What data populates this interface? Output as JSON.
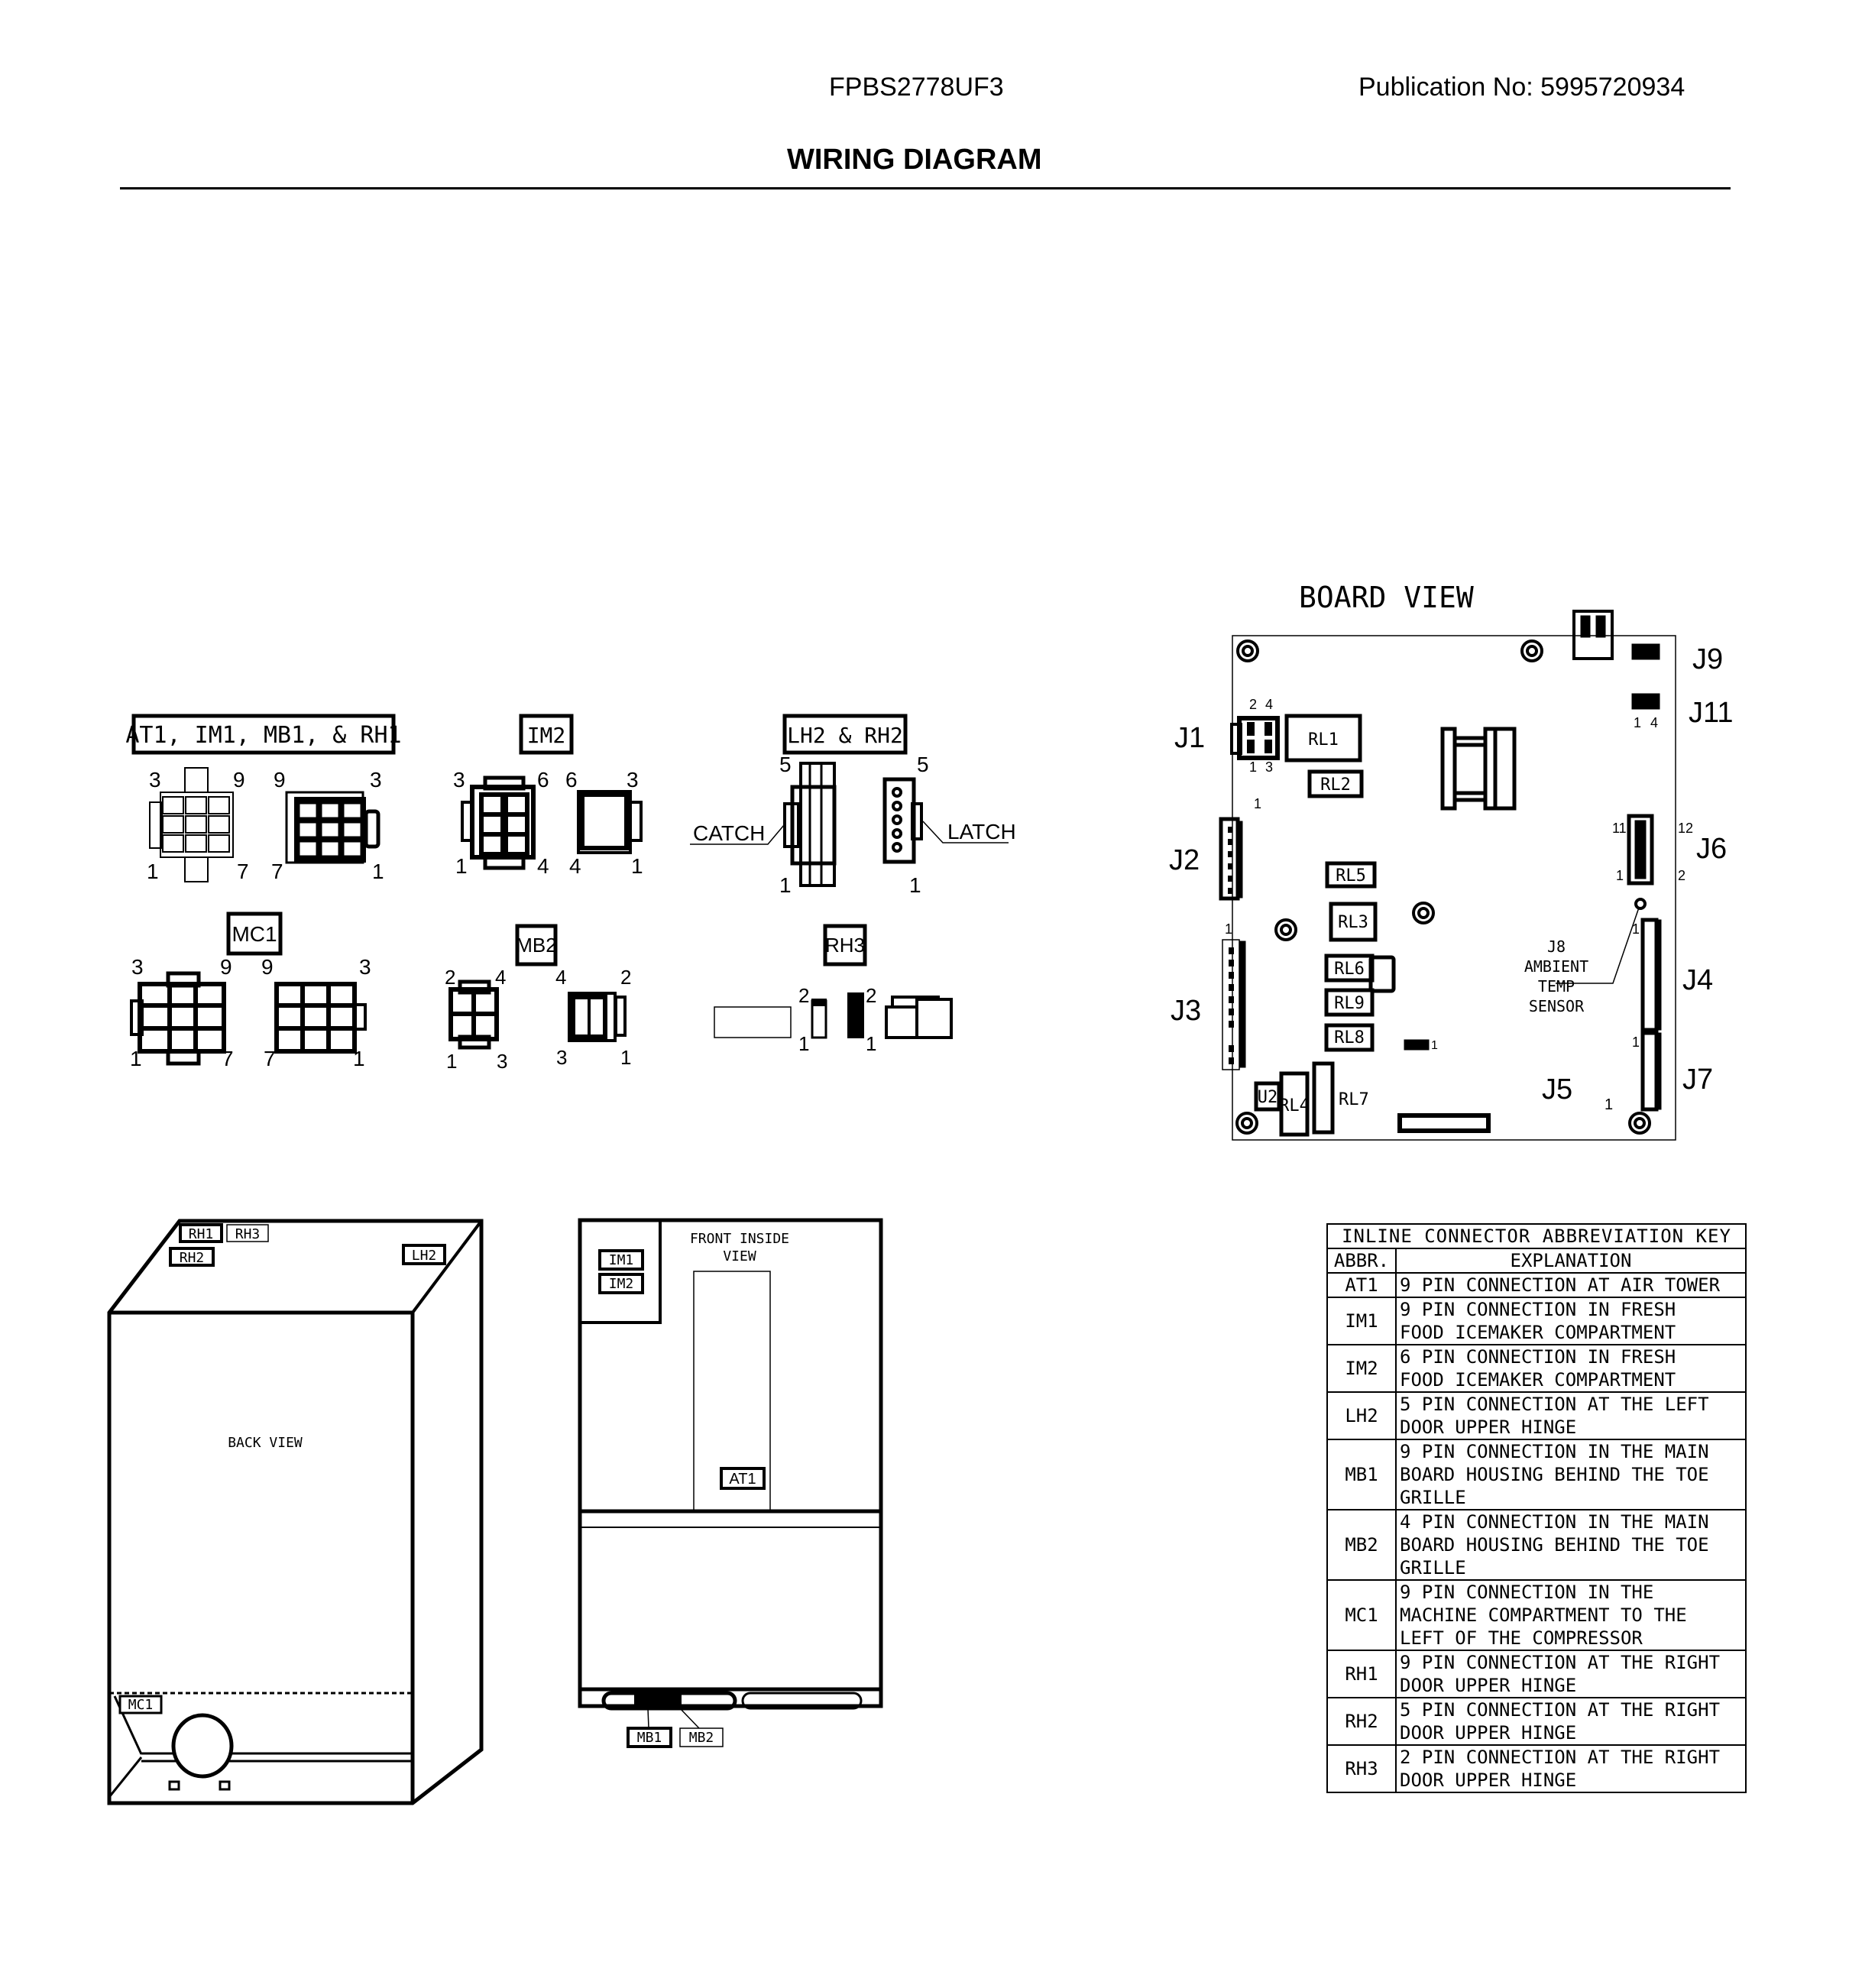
{
  "header": {
    "model": "FPBS2778UF3",
    "publication": "Publication No:  5995720934",
    "title": "WIRING DIAGRAM"
  },
  "connectors": {
    "at1_group": {
      "title": "AT1, IM1, MB1, & RH1",
      "pins_left": [
        "3",
        "9",
        "1",
        "7"
      ],
      "pins_right": [
        "9",
        "3",
        "7",
        "1"
      ]
    },
    "im2": {
      "title": "IM2",
      "pins_left": [
        "3",
        "6",
        "1",
        "4"
      ],
      "pins_right": [
        "6",
        "3",
        "4",
        "1"
      ]
    },
    "lh2_rh2": {
      "title": "LH2 & RH2",
      "pins_left": [
        "5",
        "1"
      ],
      "pins_right": [
        "5",
        "1"
      ],
      "catch_label": "CATCH",
      "latch_label": "LATCH"
    },
    "mc1": {
      "title": "MC1",
      "pins_left": [
        "3",
        "9",
        "1",
        "7"
      ],
      "pins_right": [
        "9",
        "3",
        "7",
        "1"
      ]
    },
    "mb2": {
      "title": "MB2",
      "pins_left": [
        "2",
        "4",
        "1",
        "3"
      ],
      "pins_right": [
        "4",
        "2",
        "3",
        "1"
      ]
    },
    "rh3": {
      "title": "RH3",
      "pins_a": [
        "2",
        "1"
      ],
      "pins_b": [
        "2",
        "1"
      ]
    }
  },
  "board": {
    "title": "BOARD VIEW",
    "jacks": [
      "J1",
      "J2",
      "J3",
      "J4",
      "J5",
      "J6",
      "J7",
      "J9",
      "J11"
    ],
    "relays": [
      "RL1",
      "RL2",
      "RL3",
      "RL4",
      "RL5",
      "RL6",
      "RL7",
      "RL8",
      "RL9"
    ],
    "u2": "U2",
    "j1_pins": [
      "2",
      "4",
      "1",
      "3"
    ],
    "j11_pins": [
      "1",
      "4"
    ],
    "j6_pins": [
      "11",
      "12",
      "1",
      "2"
    ],
    "j2_pin": "1",
    "j3_pin": "1",
    "j4_pin": "1",
    "j7_pin": "1",
    "j5_pin": "1",
    "small_header_pin": "1",
    "j8_label": [
      "J8",
      "AMBIENT",
      "TEMP",
      "SENSOR"
    ]
  },
  "back_view": {
    "label": "BACK VIEW",
    "tags": [
      "RH1",
      "RH3",
      "RH2",
      "LH2",
      "MC1"
    ]
  },
  "front_view": {
    "label": [
      "FRONT INSIDE",
      "VIEW"
    ],
    "tags": [
      "IM1",
      "IM2",
      "AT1",
      "MB1",
      "MB2"
    ]
  },
  "key_table": {
    "caption": "INLINE CONNECTOR ABBREVIATION KEY",
    "headers": [
      "ABBR.",
      "EXPLANATION"
    ],
    "rows": [
      {
        "abbr": "AT1",
        "exp": "9 PIN CONNECTION AT AIR TOWER"
      },
      {
        "abbr": "IM1",
        "exp": "9 PIN CONNECTION IN FRESH\nFOOD ICEMAKER COMPARTMENT"
      },
      {
        "abbr": "IM2",
        "exp": "6 PIN CONNECTION IN FRESH\nFOOD ICEMAKER COMPARTMENT"
      },
      {
        "abbr": "LH2",
        "exp": "5 PIN CONNECTION AT THE LEFT\nDOOR UPPER HINGE"
      },
      {
        "abbr": "MB1",
        "exp": "9 PIN CONNECTION IN THE MAIN\nBOARD HOUSING BEHIND THE TOE\nGRILLE"
      },
      {
        "abbr": "MB2",
        "exp": "4 PIN CONNECTION IN THE MAIN\nBOARD HOUSING BEHIND THE TOE\nGRILLE"
      },
      {
        "abbr": "MC1",
        "exp": "9 PIN CONNECTION IN THE\nMACHINE COMPARTMENT TO THE\nLEFT OF THE COMPRESSOR"
      },
      {
        "abbr": "RH1",
        "exp": "9 PIN CONNECTION AT THE RIGHT\nDOOR UPPER HINGE"
      },
      {
        "abbr": "RH2",
        "exp": "5 PIN CONNECTION AT THE RIGHT\nDOOR UPPER HINGE"
      },
      {
        "abbr": "RH3",
        "exp": "2 PIN CONNECTION AT THE RIGHT\nDOOR UPPER HINGE"
      }
    ]
  }
}
